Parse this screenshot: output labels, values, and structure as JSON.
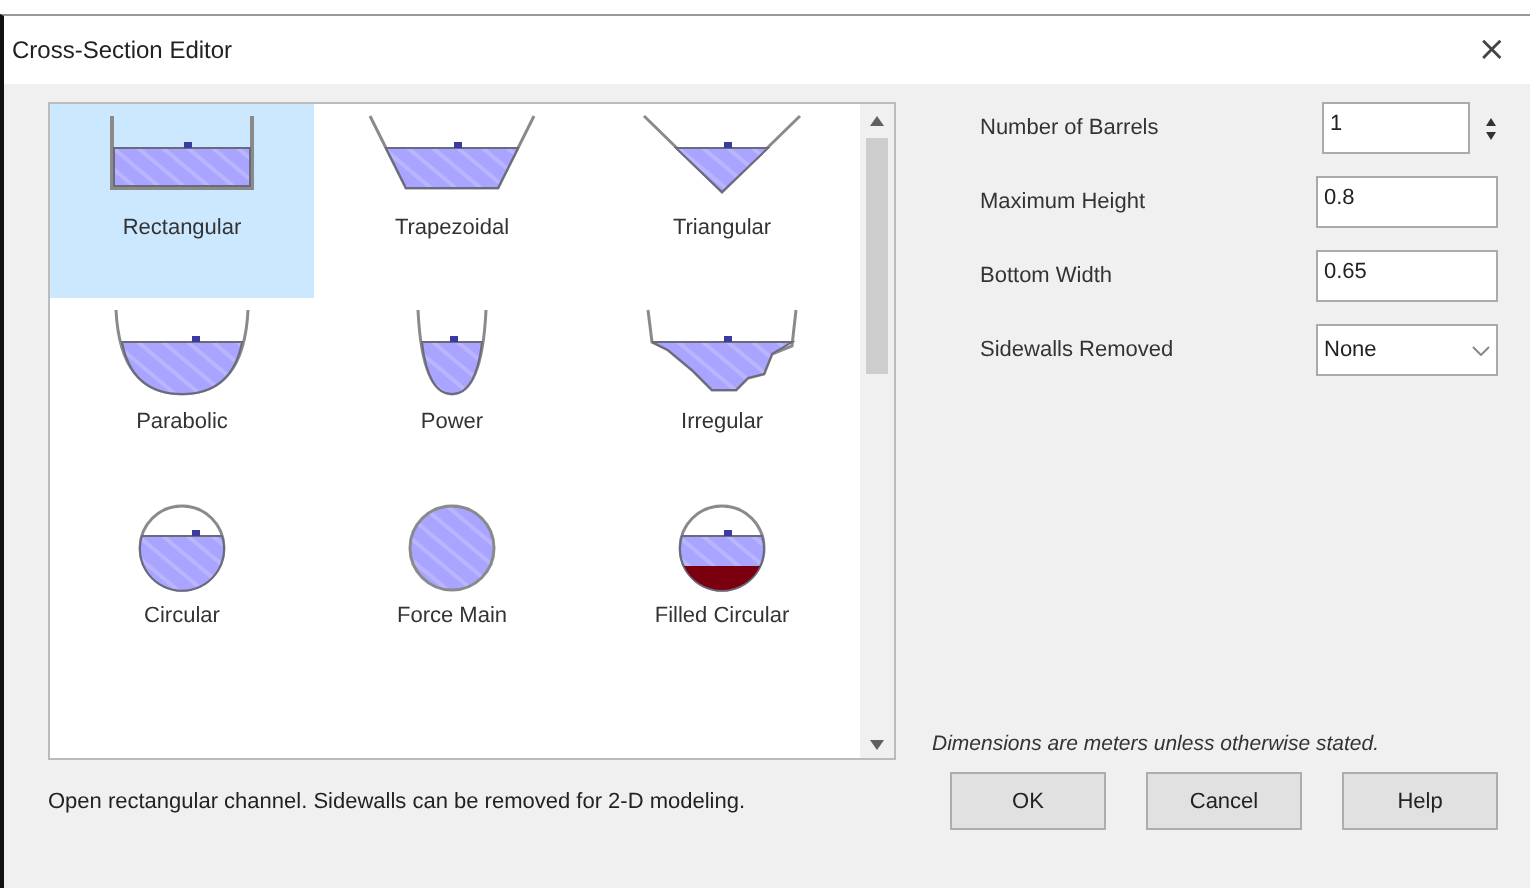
{
  "window": {
    "title": "Cross-Section Editor",
    "close": "×"
  },
  "shapes": [
    {
      "label": "Rectangular",
      "kind": "rectangular",
      "selected": true
    },
    {
      "label": "Trapezoidal",
      "kind": "trapezoidal",
      "selected": false
    },
    {
      "label": "Triangular",
      "kind": "triangular",
      "selected": false
    },
    {
      "label": "Parabolic",
      "kind": "parabolic",
      "selected": false
    },
    {
      "label": "Power",
      "kind": "power",
      "selected": false
    },
    {
      "label": "Irregular",
      "kind": "irregular",
      "selected": false
    },
    {
      "label": "Circular",
      "kind": "circular",
      "selected": false
    },
    {
      "label": "Force Main",
      "kind": "force_main",
      "selected": false
    },
    {
      "label": "Filled Circular",
      "kind": "filled_circular",
      "selected": false
    }
  ],
  "fields": [
    {
      "label": "Number of Barrels",
      "kind": "spinner",
      "value": "1"
    },
    {
      "label": "Maximum Height",
      "kind": "text",
      "value": "0.8"
    },
    {
      "label": "Bottom Width",
      "kind": "text",
      "value": "0.65"
    },
    {
      "label": "Sidewalls Removed",
      "kind": "dropdown",
      "value": "None"
    }
  ],
  "note": "Dimensions are meters unless otherwise stated.",
  "description": "Open rectangular channel. Sidewalls can be removed for 2-D modeling.",
  "buttons": [
    "OK",
    "Cancel",
    "Help"
  ]
}
